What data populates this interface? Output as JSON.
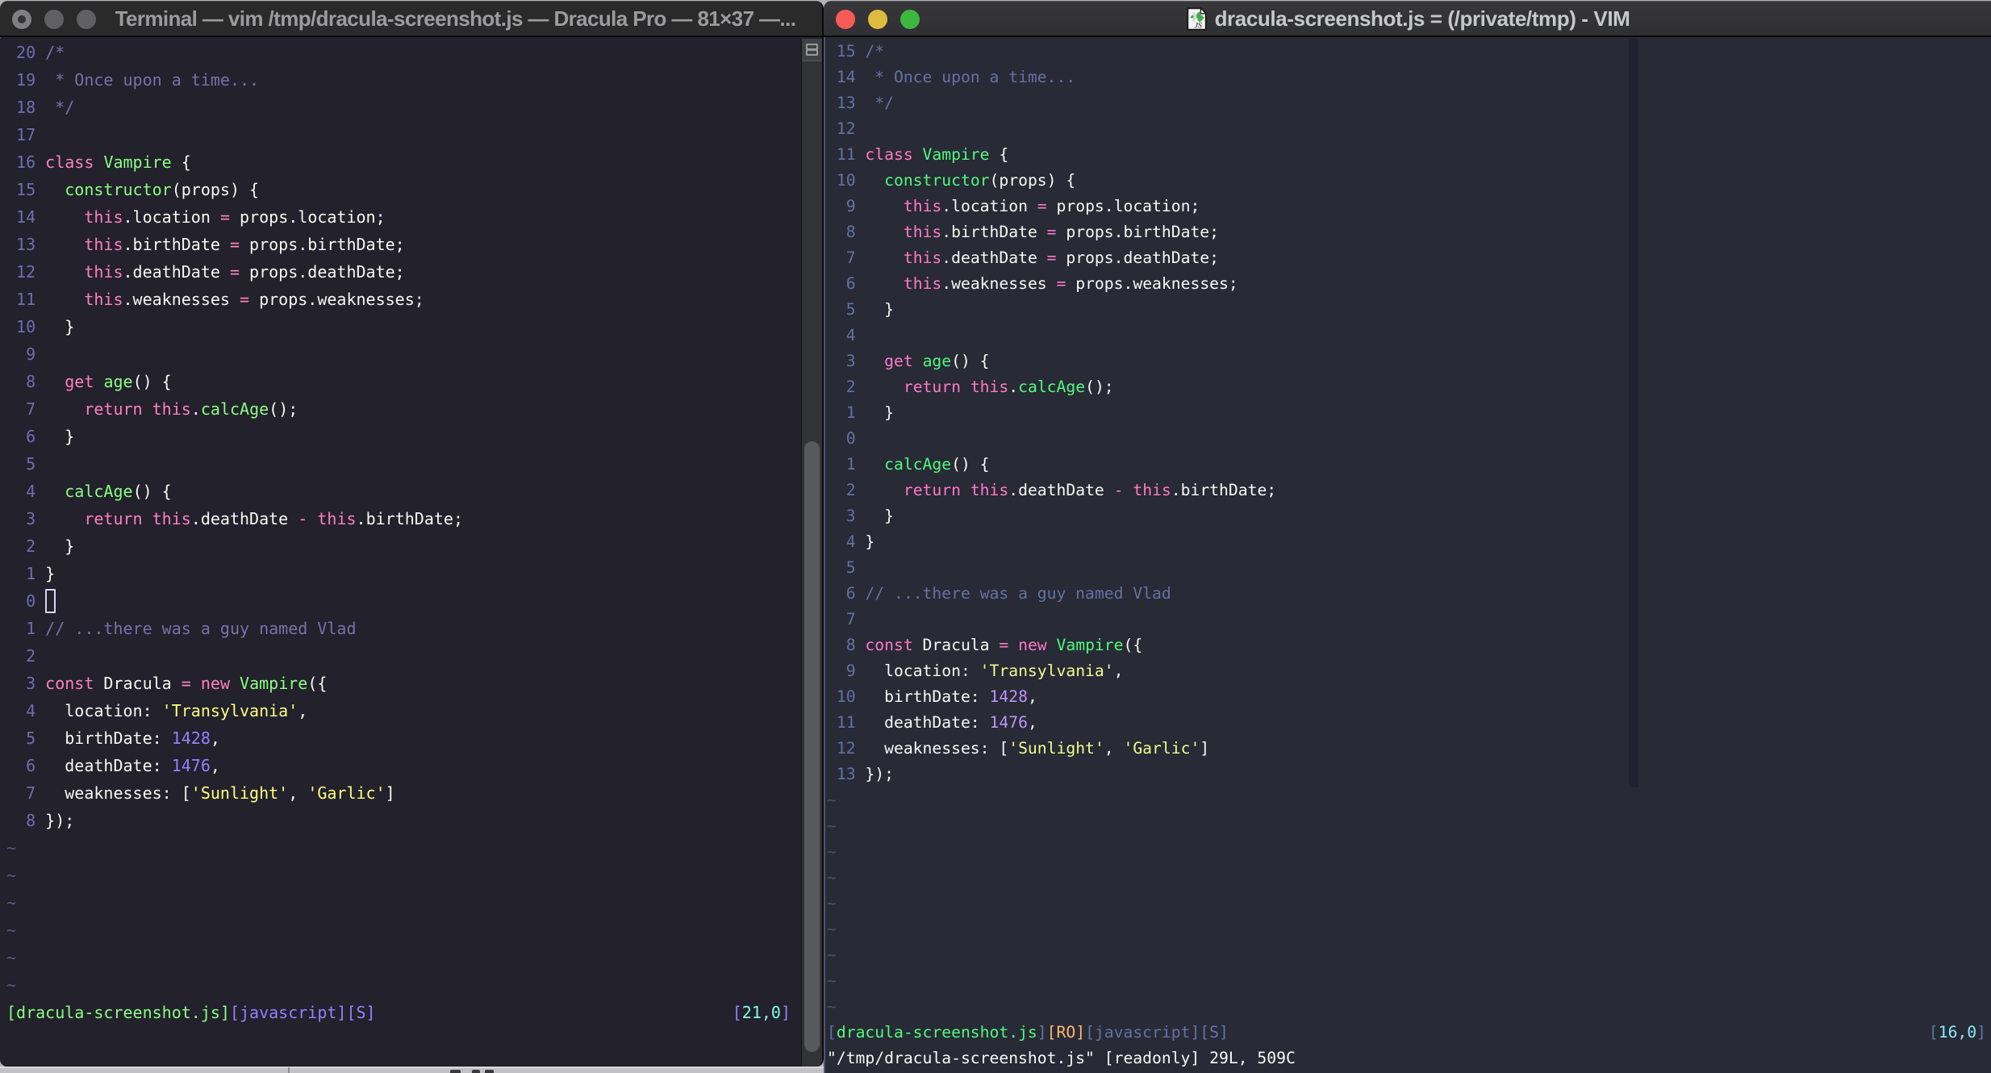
{
  "left_window": {
    "app": "Terminal",
    "title": "Terminal — vim /tmp/dracula-screenshot.js — Dracula Pro — 81×37 —...",
    "theme_name": "Dracula Pro",
    "grid_size": "81×37",
    "traffic_lights": [
      "close",
      "minimize",
      "zoom"
    ],
    "palette": {
      "bg": "#22212c",
      "fg": "#f8f8f2",
      "comment": "#7970a9",
      "lnum": "#706cb0",
      "tilde": "#5b5682",
      "pink": "#ff80bf",
      "green": "#8aff80",
      "purple": "#9580ff",
      "yellow": "#ffff80",
      "cyan": "#80ffea",
      "orange": "#ffca80",
      "blue": "#7970a9"
    },
    "editor": {
      "lines": [
        {
          "num": "20",
          "tokens": [
            [
              "comment",
              "/*"
            ]
          ]
        },
        {
          "num": "19",
          "tokens": [
            [
              "comment",
              " * Once upon a time..."
            ]
          ]
        },
        {
          "num": "18",
          "tokens": [
            [
              "comment",
              " */"
            ]
          ]
        },
        {
          "num": "17",
          "tokens": []
        },
        {
          "num": "16",
          "tokens": [
            [
              "pink",
              "class"
            ],
            [
              "fg",
              " "
            ],
            [
              "green",
              "Vampire"
            ],
            [
              "fg",
              " {"
            ]
          ]
        },
        {
          "num": "15",
          "tokens": [
            [
              "fg",
              "  "
            ],
            [
              "green",
              "constructor"
            ],
            [
              "fg",
              "(props) {"
            ]
          ]
        },
        {
          "num": "14",
          "tokens": [
            [
              "fg",
              "    "
            ],
            [
              "pink",
              "this"
            ],
            [
              "fg",
              ".location "
            ],
            [
              "pink",
              "="
            ],
            [
              "fg",
              " props.location;"
            ]
          ]
        },
        {
          "num": "13",
          "tokens": [
            [
              "fg",
              "    "
            ],
            [
              "pink",
              "this"
            ],
            [
              "fg",
              ".birthDate "
            ],
            [
              "pink",
              "="
            ],
            [
              "fg",
              " props.birthDate;"
            ]
          ]
        },
        {
          "num": "12",
          "tokens": [
            [
              "fg",
              "    "
            ],
            [
              "pink",
              "this"
            ],
            [
              "fg",
              ".deathDate "
            ],
            [
              "pink",
              "="
            ],
            [
              "fg",
              " props.deathDate;"
            ]
          ]
        },
        {
          "num": "11",
          "tokens": [
            [
              "fg",
              "    "
            ],
            [
              "pink",
              "this"
            ],
            [
              "fg",
              ".weaknesses "
            ],
            [
              "pink",
              "="
            ],
            [
              "fg",
              " props.weaknesses;"
            ]
          ]
        },
        {
          "num": "10",
          "tokens": [
            [
              "fg",
              "  }"
            ]
          ]
        },
        {
          "num": "9",
          "tokens": []
        },
        {
          "num": "8",
          "tokens": [
            [
              "fg",
              "  "
            ],
            [
              "pink",
              "get"
            ],
            [
              "fg",
              " "
            ],
            [
              "green",
              "age"
            ],
            [
              "fg",
              "() {"
            ]
          ]
        },
        {
          "num": "7",
          "tokens": [
            [
              "fg",
              "    "
            ],
            [
              "pink",
              "return"
            ],
            [
              "fg",
              " "
            ],
            [
              "pink",
              "this"
            ],
            [
              "fg",
              "."
            ],
            [
              "green",
              "calcAge"
            ],
            [
              "fg",
              "();"
            ]
          ]
        },
        {
          "num": "6",
          "tokens": [
            [
              "fg",
              "  }"
            ]
          ]
        },
        {
          "num": "5",
          "tokens": []
        },
        {
          "num": "4",
          "tokens": [
            [
              "fg",
              "  "
            ],
            [
              "green",
              "calcAge"
            ],
            [
              "fg",
              "() {"
            ]
          ]
        },
        {
          "num": "3",
          "tokens": [
            [
              "fg",
              "    "
            ],
            [
              "pink",
              "return"
            ],
            [
              "fg",
              " "
            ],
            [
              "pink",
              "this"
            ],
            [
              "fg",
              ".deathDate "
            ],
            [
              "pink",
              "-"
            ],
            [
              "fg",
              " "
            ],
            [
              "pink",
              "this"
            ],
            [
              "fg",
              ".birthDate;"
            ]
          ]
        },
        {
          "num": "2",
          "tokens": [
            [
              "fg",
              "  }"
            ]
          ]
        },
        {
          "num": "1",
          "tokens": [
            [
              "fg",
              "}"
            ]
          ]
        },
        {
          "num": "0",
          "tokens": [],
          "cursor": true
        },
        {
          "num": "1",
          "tokens": [
            [
              "comment",
              "// ...there was a guy named Vlad"
            ]
          ]
        },
        {
          "num": "2",
          "tokens": []
        },
        {
          "num": "3",
          "tokens": [
            [
              "pink",
              "const"
            ],
            [
              "fg",
              " Dracula "
            ],
            [
              "pink",
              "="
            ],
            [
              "fg",
              " "
            ],
            [
              "pink",
              "new"
            ],
            [
              "fg",
              " "
            ],
            [
              "green",
              "Vampire"
            ],
            [
              "fg",
              "({"
            ]
          ]
        },
        {
          "num": "4",
          "tokens": [
            [
              "fg",
              "  location: "
            ],
            [
              "yellow",
              "'Transylvania'"
            ],
            [
              "fg",
              ","
            ]
          ]
        },
        {
          "num": "5",
          "tokens": [
            [
              "fg",
              "  birthDate: "
            ],
            [
              "purple",
              "1428"
            ],
            [
              "fg",
              ","
            ]
          ]
        },
        {
          "num": "6",
          "tokens": [
            [
              "fg",
              "  deathDate: "
            ],
            [
              "purple",
              "1476"
            ],
            [
              "fg",
              ","
            ]
          ]
        },
        {
          "num": "7",
          "tokens": [
            [
              "fg",
              "  weaknesses: ["
            ],
            [
              "yellow",
              "'Sunlight'"
            ],
            [
              "fg",
              ", "
            ],
            [
              "yellow",
              "'Garlic'"
            ],
            [
              "fg",
              "]"
            ]
          ]
        },
        {
          "num": "8",
          "tokens": [
            [
              "fg",
              "});"
            ]
          ]
        }
      ],
      "tilde_count": 6,
      "tilde_char": "~",
      "status_segments": [
        [
          "green",
          "[dracula-screenshot.js]"
        ],
        [
          "purple",
          "[javascript][S]"
        ]
      ],
      "ruler_segments": [
        [
          "purple",
          "["
        ],
        [
          "cyan",
          "21,0"
        ],
        [
          "purple",
          "]"
        ]
      ],
      "command_line_segments": []
    }
  },
  "right_window": {
    "app": "MacVim",
    "title": "dracula-screenshot.js = (/private/tmp) - VIM",
    "doc_icon": "js-file-vim-icon",
    "traffic_lights": [
      "close",
      "minimize",
      "zoom"
    ],
    "traffic_light_colors": {
      "close": "#f75b56",
      "minimize": "#dfba40",
      "zoom": "#3db83f"
    },
    "palette": {
      "bg": "#282a36",
      "fg": "#f8f8f2",
      "comment": "#6272a4",
      "lnum": "#6272a4",
      "tilde": "#4b5263",
      "pink": "#ff79c6",
      "green": "#50fa7b",
      "purple": "#bd93f9",
      "yellow": "#f1fa8c",
      "cyan": "#8be9fd",
      "orange": "#ffb86c",
      "blue": "#6272a4"
    },
    "editor": {
      "lines": [
        {
          "num": "15",
          "tokens": [
            [
              "comment",
              "/*"
            ]
          ]
        },
        {
          "num": "14",
          "tokens": [
            [
              "comment",
              " * Once upon a time..."
            ]
          ]
        },
        {
          "num": "13",
          "tokens": [
            [
              "comment",
              " */"
            ]
          ]
        },
        {
          "num": "12",
          "tokens": []
        },
        {
          "num": "11",
          "tokens": [
            [
              "pink",
              "class"
            ],
            [
              "fg",
              " "
            ],
            [
              "green",
              "Vampire"
            ],
            [
              "fg",
              " {"
            ]
          ]
        },
        {
          "num": "10",
          "tokens": [
            [
              "fg",
              "  "
            ],
            [
              "green",
              "constructor"
            ],
            [
              "fg",
              "(props) {"
            ]
          ]
        },
        {
          "num": "9",
          "tokens": [
            [
              "fg",
              "    "
            ],
            [
              "pink",
              "this"
            ],
            [
              "fg",
              ".location "
            ],
            [
              "pink",
              "="
            ],
            [
              "fg",
              " props.location;"
            ]
          ]
        },
        {
          "num": "8",
          "tokens": [
            [
              "fg",
              "    "
            ],
            [
              "pink",
              "this"
            ],
            [
              "fg",
              ".birthDate "
            ],
            [
              "pink",
              "="
            ],
            [
              "fg",
              " props.birthDate;"
            ]
          ]
        },
        {
          "num": "7",
          "tokens": [
            [
              "fg",
              "    "
            ],
            [
              "pink",
              "this"
            ],
            [
              "fg",
              ".deathDate "
            ],
            [
              "pink",
              "="
            ],
            [
              "fg",
              " props.deathDate;"
            ]
          ]
        },
        {
          "num": "6",
          "tokens": [
            [
              "fg",
              "    "
            ],
            [
              "pink",
              "this"
            ],
            [
              "fg",
              ".weaknesses "
            ],
            [
              "pink",
              "="
            ],
            [
              "fg",
              " props.weaknesses;"
            ]
          ]
        },
        {
          "num": "5",
          "tokens": [
            [
              "fg",
              "  }"
            ]
          ]
        },
        {
          "num": "4",
          "tokens": []
        },
        {
          "num": "3",
          "tokens": [
            [
              "fg",
              "  "
            ],
            [
              "pink",
              "get"
            ],
            [
              "fg",
              " "
            ],
            [
              "green",
              "age"
            ],
            [
              "fg",
              "() {"
            ]
          ]
        },
        {
          "num": "2",
          "tokens": [
            [
              "fg",
              "    "
            ],
            [
              "pink",
              "return"
            ],
            [
              "fg",
              " "
            ],
            [
              "pink",
              "this"
            ],
            [
              "fg",
              "."
            ],
            [
              "green",
              "calcAge"
            ],
            [
              "fg",
              "();"
            ]
          ]
        },
        {
          "num": "1",
          "tokens": [
            [
              "fg",
              "  }"
            ]
          ]
        },
        {
          "num": "0",
          "tokens": []
        },
        {
          "num": "1",
          "tokens": [
            [
              "fg",
              "  "
            ],
            [
              "green",
              "calcAge"
            ],
            [
              "fg",
              "() {"
            ]
          ]
        },
        {
          "num": "2",
          "tokens": [
            [
              "fg",
              "    "
            ],
            [
              "pink",
              "return"
            ],
            [
              "fg",
              " "
            ],
            [
              "pink",
              "this"
            ],
            [
              "fg",
              ".deathDate "
            ],
            [
              "pink",
              "-"
            ],
            [
              "fg",
              " "
            ],
            [
              "pink",
              "this"
            ],
            [
              "fg",
              ".birthDate;"
            ]
          ]
        },
        {
          "num": "3",
          "tokens": [
            [
              "fg",
              "  }"
            ]
          ]
        },
        {
          "num": "4",
          "tokens": [
            [
              "fg",
              "}"
            ]
          ]
        },
        {
          "num": "5",
          "tokens": []
        },
        {
          "num": "6",
          "tokens": [
            [
              "comment",
              "// ...there was a guy named Vlad"
            ]
          ]
        },
        {
          "num": "7",
          "tokens": []
        },
        {
          "num": "8",
          "tokens": [
            [
              "pink",
              "const"
            ],
            [
              "fg",
              " Dracula "
            ],
            [
              "pink",
              "="
            ],
            [
              "fg",
              " "
            ],
            [
              "pink",
              "new"
            ],
            [
              "fg",
              " "
            ],
            [
              "green",
              "Vampire"
            ],
            [
              "fg",
              "({"
            ]
          ]
        },
        {
          "num": "9",
          "tokens": [
            [
              "fg",
              "  location: "
            ],
            [
              "yellow",
              "'Transylvania'"
            ],
            [
              "fg",
              ","
            ]
          ]
        },
        {
          "num": "10",
          "tokens": [
            [
              "fg",
              "  birthDate: "
            ],
            [
              "purple",
              "1428"
            ],
            [
              "fg",
              ","
            ]
          ]
        },
        {
          "num": "11",
          "tokens": [
            [
              "fg",
              "  deathDate: "
            ],
            [
              "purple",
              "1476"
            ],
            [
              "fg",
              ","
            ]
          ]
        },
        {
          "num": "12",
          "tokens": [
            [
              "fg",
              "  weaknesses: ["
            ],
            [
              "yellow",
              "'Sunlight'"
            ],
            [
              "fg",
              ", "
            ],
            [
              "yellow",
              "'Garlic'"
            ],
            [
              "fg",
              "]"
            ]
          ]
        },
        {
          "num": "13",
          "tokens": [
            [
              "fg",
              "});"
            ]
          ]
        }
      ],
      "tilde_count": 9,
      "tilde_char": "~",
      "status_segments": [
        [
          "blue",
          "["
        ],
        [
          "green",
          "dracula-screenshot.js"
        ],
        [
          "blue",
          "]"
        ],
        [
          "orange",
          "[RO]"
        ],
        [
          "blue",
          "[javascript][S]"
        ]
      ],
      "ruler_segments": [
        [
          "blue",
          "["
        ],
        [
          "cyan",
          "16,0"
        ],
        [
          "blue",
          "]"
        ]
      ],
      "command_line_segments": [
        [
          "fg",
          "\"/tmp/dracula-screenshot.js\" [readonly] 29L, 509C"
        ]
      ]
    }
  }
}
